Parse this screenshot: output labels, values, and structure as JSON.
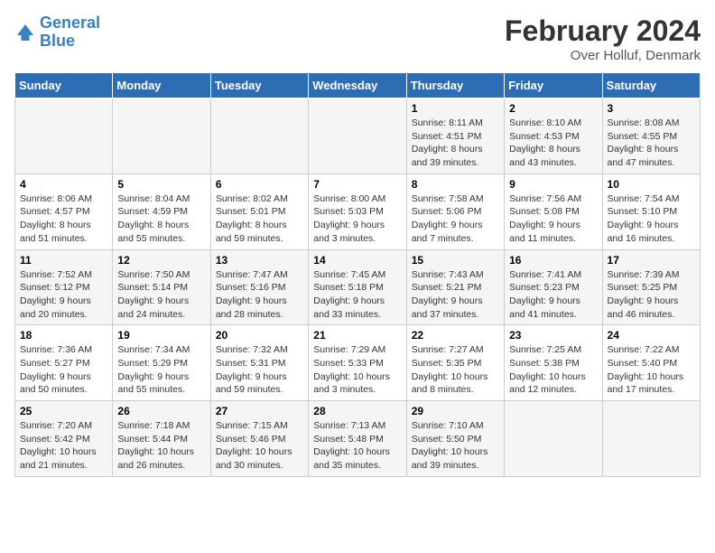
{
  "logo": {
    "line1": "General",
    "line2": "Blue"
  },
  "title": "February 2024",
  "subtitle": "Over Holluf, Denmark",
  "days_header": [
    "Sunday",
    "Monday",
    "Tuesday",
    "Wednesday",
    "Thursday",
    "Friday",
    "Saturday"
  ],
  "weeks": [
    [
      {
        "day": "",
        "info": ""
      },
      {
        "day": "",
        "info": ""
      },
      {
        "day": "",
        "info": ""
      },
      {
        "day": "",
        "info": ""
      },
      {
        "day": "1",
        "info": "Sunrise: 8:11 AM\nSunset: 4:51 PM\nDaylight: 8 hours\nand 39 minutes."
      },
      {
        "day": "2",
        "info": "Sunrise: 8:10 AM\nSunset: 4:53 PM\nDaylight: 8 hours\nand 43 minutes."
      },
      {
        "day": "3",
        "info": "Sunrise: 8:08 AM\nSunset: 4:55 PM\nDaylight: 8 hours\nand 47 minutes."
      }
    ],
    [
      {
        "day": "4",
        "info": "Sunrise: 8:06 AM\nSunset: 4:57 PM\nDaylight: 8 hours\nand 51 minutes."
      },
      {
        "day": "5",
        "info": "Sunrise: 8:04 AM\nSunset: 4:59 PM\nDaylight: 8 hours\nand 55 minutes."
      },
      {
        "day": "6",
        "info": "Sunrise: 8:02 AM\nSunset: 5:01 PM\nDaylight: 8 hours\nand 59 minutes."
      },
      {
        "day": "7",
        "info": "Sunrise: 8:00 AM\nSunset: 5:03 PM\nDaylight: 9 hours\nand 3 minutes."
      },
      {
        "day": "8",
        "info": "Sunrise: 7:58 AM\nSunset: 5:06 PM\nDaylight: 9 hours\nand 7 minutes."
      },
      {
        "day": "9",
        "info": "Sunrise: 7:56 AM\nSunset: 5:08 PM\nDaylight: 9 hours\nand 11 minutes."
      },
      {
        "day": "10",
        "info": "Sunrise: 7:54 AM\nSunset: 5:10 PM\nDaylight: 9 hours\nand 16 minutes."
      }
    ],
    [
      {
        "day": "11",
        "info": "Sunrise: 7:52 AM\nSunset: 5:12 PM\nDaylight: 9 hours\nand 20 minutes."
      },
      {
        "day": "12",
        "info": "Sunrise: 7:50 AM\nSunset: 5:14 PM\nDaylight: 9 hours\nand 24 minutes."
      },
      {
        "day": "13",
        "info": "Sunrise: 7:47 AM\nSunset: 5:16 PM\nDaylight: 9 hours\nand 28 minutes."
      },
      {
        "day": "14",
        "info": "Sunrise: 7:45 AM\nSunset: 5:18 PM\nDaylight: 9 hours\nand 33 minutes."
      },
      {
        "day": "15",
        "info": "Sunrise: 7:43 AM\nSunset: 5:21 PM\nDaylight: 9 hours\nand 37 minutes."
      },
      {
        "day": "16",
        "info": "Sunrise: 7:41 AM\nSunset: 5:23 PM\nDaylight: 9 hours\nand 41 minutes."
      },
      {
        "day": "17",
        "info": "Sunrise: 7:39 AM\nSunset: 5:25 PM\nDaylight: 9 hours\nand 46 minutes."
      }
    ],
    [
      {
        "day": "18",
        "info": "Sunrise: 7:36 AM\nSunset: 5:27 PM\nDaylight: 9 hours\nand 50 minutes."
      },
      {
        "day": "19",
        "info": "Sunrise: 7:34 AM\nSunset: 5:29 PM\nDaylight: 9 hours\nand 55 minutes."
      },
      {
        "day": "20",
        "info": "Sunrise: 7:32 AM\nSunset: 5:31 PM\nDaylight: 9 hours\nand 59 minutes."
      },
      {
        "day": "21",
        "info": "Sunrise: 7:29 AM\nSunset: 5:33 PM\nDaylight: 10 hours\nand 3 minutes."
      },
      {
        "day": "22",
        "info": "Sunrise: 7:27 AM\nSunset: 5:35 PM\nDaylight: 10 hours\nand 8 minutes."
      },
      {
        "day": "23",
        "info": "Sunrise: 7:25 AM\nSunset: 5:38 PM\nDaylight: 10 hours\nand 12 minutes."
      },
      {
        "day": "24",
        "info": "Sunrise: 7:22 AM\nSunset: 5:40 PM\nDaylight: 10 hours\nand 17 minutes."
      }
    ],
    [
      {
        "day": "25",
        "info": "Sunrise: 7:20 AM\nSunset: 5:42 PM\nDaylight: 10 hours\nand 21 minutes."
      },
      {
        "day": "26",
        "info": "Sunrise: 7:18 AM\nSunset: 5:44 PM\nDaylight: 10 hours\nand 26 minutes."
      },
      {
        "day": "27",
        "info": "Sunrise: 7:15 AM\nSunset: 5:46 PM\nDaylight: 10 hours\nand 30 minutes."
      },
      {
        "day": "28",
        "info": "Sunrise: 7:13 AM\nSunset: 5:48 PM\nDaylight: 10 hours\nand 35 minutes."
      },
      {
        "day": "29",
        "info": "Sunrise: 7:10 AM\nSunset: 5:50 PM\nDaylight: 10 hours\nand 39 minutes."
      },
      {
        "day": "",
        "info": ""
      },
      {
        "day": "",
        "info": ""
      }
    ]
  ]
}
